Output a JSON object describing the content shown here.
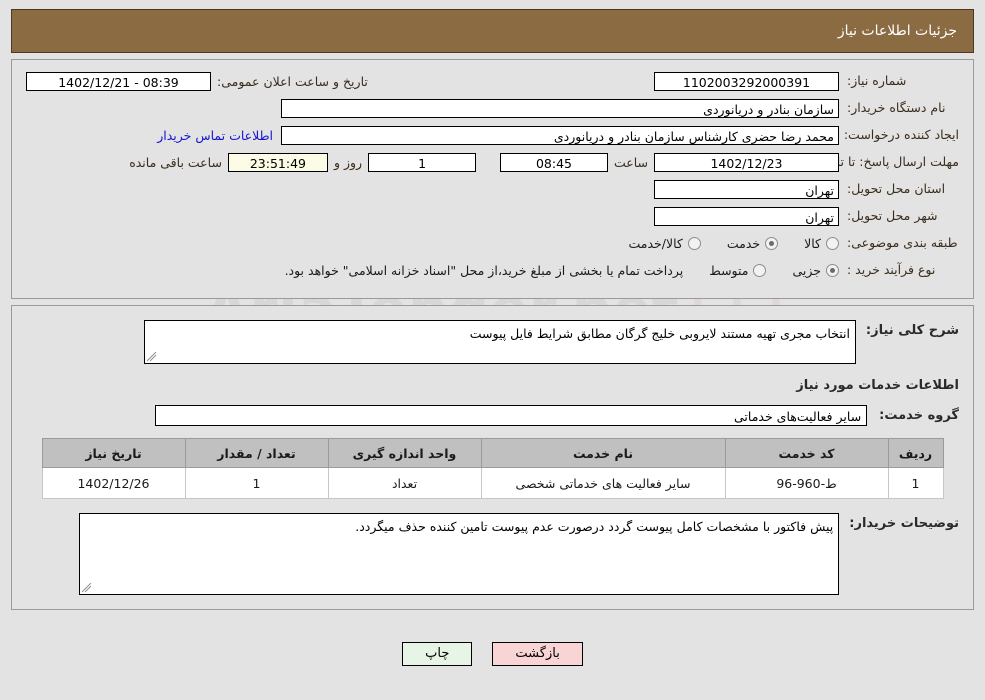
{
  "header": {
    "title": "جزئیات اطلاعات نیاز",
    "bg_color": "#8b6b42"
  },
  "watermark": {
    "text": "AriaTender.net"
  },
  "top_form": {
    "need_number_label": "شماره نیاز:",
    "need_number_value": "1102003292000391",
    "public_announce_label": "تاریخ و ساعت اعلان عمومی:",
    "public_announce_value": "08:39 - 1402/12/21",
    "buyer_org_label": "نام دستگاه خریدار:",
    "buyer_org_value": "سازمان بنادر و دریانوردی",
    "creator_label": "ایجاد کننده درخواست:",
    "creator_value": "محمد رضا حضری کارشناس سازمان بنادر و دریانوردی",
    "contact_link": "اطلاعات تماس خریدار",
    "deadline_label": "مهلت ارسال پاسخ: تا تاریخ:",
    "deadline_date": "1402/12/23",
    "deadline_hour_label": "ساعت",
    "deadline_hour_value": "08:45",
    "remaining_days_value": "1",
    "remaining_days_label": "روز و",
    "remaining_time_value": "23:51:49",
    "remaining_time_label": "ساعت باقی مانده",
    "province_label": "استان محل تحویل:",
    "province_value": "تهران",
    "city_label": "شهر محل تحویل:",
    "city_value": "تهران",
    "category_label": "طبقه بندی موضوعی:",
    "category_options": [
      {
        "label": "کالا",
        "selected": false
      },
      {
        "label": "خدمت",
        "selected": true
      },
      {
        "label": "کالا/خدمت",
        "selected": false
      }
    ],
    "process_label": "نوع فرآیند خرید :",
    "process_options": [
      {
        "label": "جزیی",
        "selected": true
      },
      {
        "label": "متوسط",
        "selected": false
      }
    ],
    "payment_note": "پرداخت تمام یا بخشی از مبلغ خرید،از محل \"اسناد خزانه اسلامی\" خواهد بود."
  },
  "details": {
    "description_label": "شرح کلی نیاز:",
    "description_value": "انتخاب مجری تهیه مستند لایروبی خلیج گرگان مطابق شرایط فایل پیوست",
    "services_heading": "اطلاعات خدمات مورد نیاز",
    "service_group_label": "گروه خدمت:",
    "service_group_value": "سایر فعالیت‌های خدماتی",
    "table": {
      "columns": [
        "ردیف",
        "کد خدمت",
        "نام خدمت",
        "واحد اندازه گیری",
        "تعداد / مقدار",
        "تاریخ نیاز"
      ],
      "rows": [
        {
          "index": "1",
          "code": "ط-960-96",
          "name": "سایر فعالیت های خدماتی شخصی",
          "unit": "تعداد",
          "qty": "1",
          "date": "1402/12/26"
        }
      ]
    },
    "buyer_notes_label": "توضیحات خریدار:",
    "buyer_notes_value": "پیش فاکتور با مشخصات کامل پیوست گردد درصورت عدم پیوست تامین کننده حذف میگردد."
  },
  "footer": {
    "print_label": "چاپ",
    "back_label": "بازگشت"
  }
}
